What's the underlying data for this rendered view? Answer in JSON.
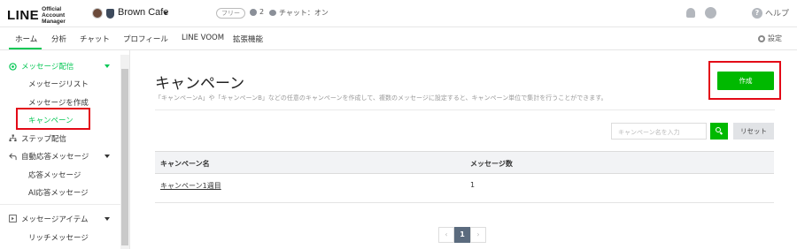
{
  "header": {
    "logo_main": "LINE",
    "logo_sub": "Official Account Manager",
    "account_name": "Brown Cafe",
    "plan_badge": "フリー",
    "followers_count": "2",
    "chat_status": "チャット：オン",
    "help_label": "ヘルプ"
  },
  "nav": {
    "tabs": [
      "ホーム",
      "分析",
      "チャット",
      "プロフィール",
      "LINE VOOM",
      "拡張機能"
    ],
    "settings_label": "設定"
  },
  "sidebar": {
    "sections": [
      {
        "label": "メッセージ配信",
        "items": [
          "メッセージリスト",
          "メッセージを作成",
          "キャンペーン"
        ]
      },
      {
        "label": "ステップ配信",
        "items": []
      },
      {
        "label": "自動応答メッセージ",
        "items": [
          "応答メッセージ",
          "AI応答メッセージ"
        ]
      },
      {
        "label": "メッセージアイテム",
        "items": [
          "リッチメッセージ"
        ]
      }
    ]
  },
  "main": {
    "title": "キャンペーン",
    "description": "「キャンペーンA」や「キャンペーンB」などの任意のキャンペーンを作成して、複数のメッセージに設定すると、キャンペーン単位で集計を行うことができます。",
    "create_button": "作成",
    "search_placeholder": "キャンペーン名を入力",
    "reset_button": "リセット",
    "table": {
      "headers": [
        "キャンペーン名",
        "メッセージ数"
      ],
      "rows": [
        {
          "name": "キャンペーン1週目",
          "count": "1"
        }
      ]
    },
    "pagination": {
      "prev": "‹",
      "current": "1",
      "next": "›"
    }
  },
  "colors": {
    "accent": "#06c755",
    "button_green": "#00b900",
    "highlight_red": "#e30a17"
  }
}
